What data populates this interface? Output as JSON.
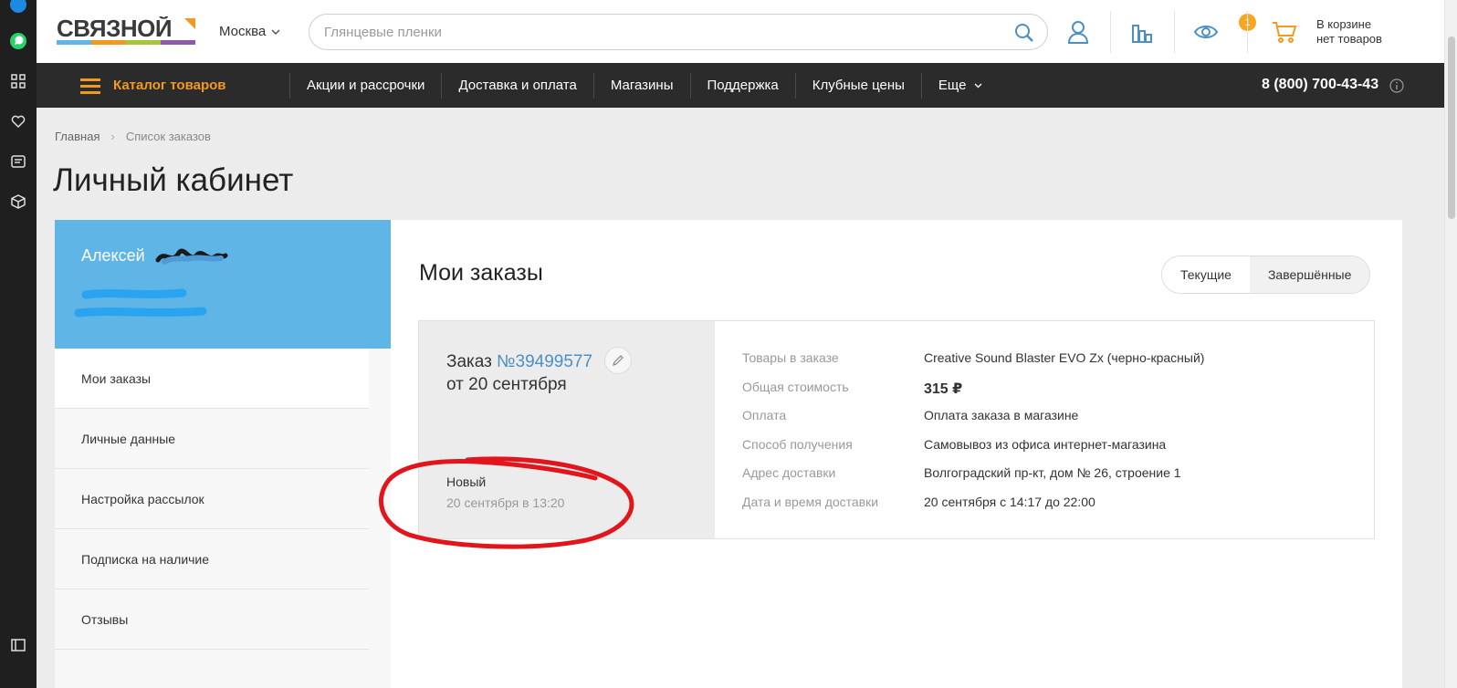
{
  "header": {
    "logo_text": "СВЯЗНОЙ",
    "city": "Москва",
    "search_placeholder": "Глянцевые пленки",
    "compare_badge": "1",
    "cart_line1": "В корзине",
    "cart_line2": "нет товаров"
  },
  "nav": {
    "catalog": "Каталог товаров",
    "items": [
      "Акции и рассрочки",
      "Доставка и оплата",
      "Магазины",
      "Поддержка",
      "Клубные цены",
      "Еще"
    ],
    "phone": "8 (800) 700-43-43"
  },
  "breadcrumb": [
    "Главная",
    "Список заказов"
  ],
  "page_title": "Личный кабинет",
  "profile": {
    "name": "Алексей"
  },
  "menu": [
    "Мои заказы",
    "Личные данные",
    "Настройка рассылок",
    "Подписка на наличие",
    "Отзывы"
  ],
  "orders": {
    "title": "Мои заказы",
    "tabs": [
      "Текущие",
      "Завершённые"
    ],
    "order": {
      "label": "Заказ",
      "number": "№39499577",
      "date": "от 20 сентября",
      "status": "Новый",
      "status_date": "20 сентября в 13:20",
      "details": [
        {
          "key": "Товары в заказе",
          "value": "Creative Sound Blaster EVO Zx (черно-красный)"
        },
        {
          "key": "Общая стоимость",
          "value": "315 ₽"
        },
        {
          "key": "Оплата",
          "value": "Оплата заказа в магазине"
        },
        {
          "key": "Способ получения",
          "value": "Самовывоз из офиса интернет-магазина"
        },
        {
          "key": "Адрес доставки",
          "value": "Волгоградский пр-кт, дом № 26, строение 1"
        },
        {
          "key": "Дата и время доставки",
          "value": "20 сентября с 14:17 до 22:00"
        }
      ]
    }
  },
  "colors": {
    "accent_orange": "#f29a1f",
    "profile_blue": "#5eb5e6",
    "link_blue": "#4a90c7",
    "annotation_red": "#e2141c"
  }
}
